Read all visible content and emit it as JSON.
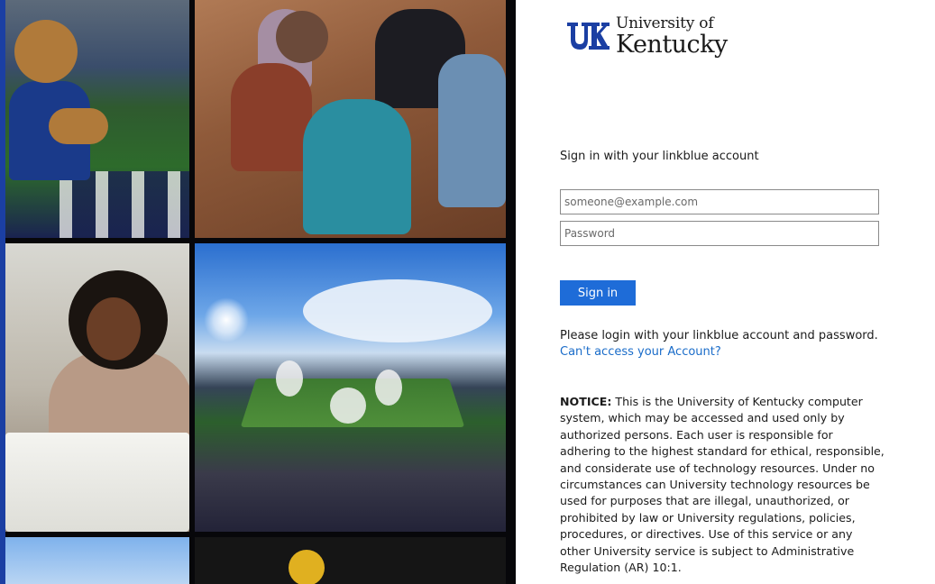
{
  "brand": {
    "line1": "University of",
    "line2": "Kentucky",
    "mark_color": "#1b3fa3"
  },
  "form": {
    "title": "Sign in with your linkblue account",
    "username_placeholder": "someone@example.com",
    "password_placeholder": "Password",
    "submit_label": "Sign in",
    "button_color": "#1e6cd8"
  },
  "help": {
    "text": "Please login with your linkblue account and password.",
    "link_text": "Can't access your Account?",
    "link_color": "#1a6cc9"
  },
  "notice": {
    "label": "NOTICE:",
    "body": " This is the University of Kentucky computer system, which may be accessed and used only by authorized persons. Each user is responsible for adhering to the highest standard for ethical, responsible, and considerate use of technology resources. Under no circumstances can University technology resources be used for purposes that are illegal, unauthorized, or prohibited by law or University regulations, policies, procedures, or directives. Use of this service or any other University service is subject to Administrative Regulation (AR) 10:1."
  },
  "collage": {
    "tiles": [
      {
        "subject": "wildcat mascot on football field"
      },
      {
        "subject": "students seated in discussion circle"
      },
      {
        "subject": "student writing in notebook"
      },
      {
        "subject": "football stadium at game time"
      },
      {
        "subject": "sky and tree"
      },
      {
        "subject": "yellow map pin on dark background"
      }
    ]
  }
}
